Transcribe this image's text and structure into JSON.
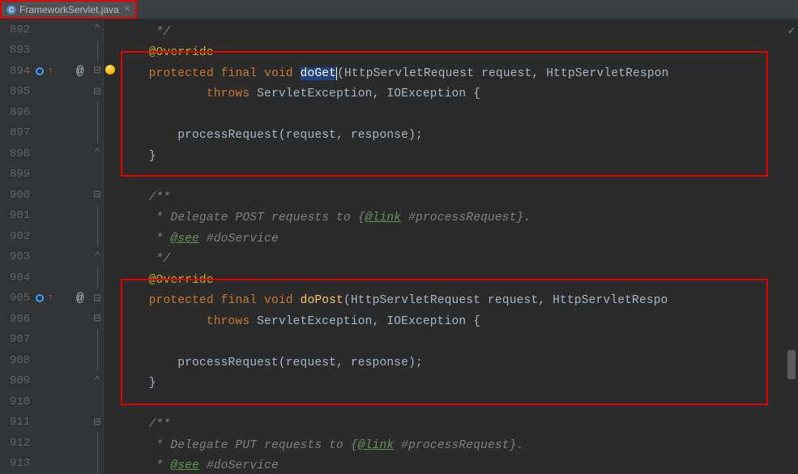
{
  "tab": {
    "filename": "FrameworkServlet.java"
  },
  "lines": {
    "l892": {
      "num": "892",
      "code": {
        "pre": "     ",
        "cm": "*/"
      }
    },
    "l893": {
      "num": "893",
      "code": {
        "pre": "    ",
        "an": "@Override"
      }
    },
    "l894": {
      "num": "894",
      "code": {
        "pre": "    ",
        "k1": "protected",
        "sp1": " ",
        "k2": "final",
        "sp2": " ",
        "k3": "void",
        "sp3": " ",
        "mth_sel": "doGet",
        "paren": "(HttpServletRequest request, HttpServletRespon"
      }
    },
    "l895": {
      "num": "895",
      "code": {
        "pre": "            ",
        "k": "throws",
        "rest": " ServletException, IOException {"
      }
    },
    "l896": {
      "num": "896"
    },
    "l897": {
      "num": "897",
      "code": {
        "pre": "        ",
        "txt": "processRequest(request, response);"
      }
    },
    "l898": {
      "num": "898",
      "code": {
        "pre": "    ",
        "txt": "}"
      }
    },
    "l899": {
      "num": "899"
    },
    "l900": {
      "num": "900",
      "code": {
        "pre": "    ",
        "cm": "/**"
      }
    },
    "l901": {
      "num": "901",
      "code": {
        "pre": "     ",
        "cm": "* Delegate POST requests to {",
        "tag": "@link",
        "cm2": " #processRequest}."
      }
    },
    "l902": {
      "num": "902",
      "code": {
        "pre": "     ",
        "cm": "* ",
        "tag": "@see",
        "cm2": " #doService"
      }
    },
    "l903": {
      "num": "903",
      "code": {
        "pre": "     ",
        "cm": "*/"
      }
    },
    "l904": {
      "num": "904",
      "code": {
        "pre": "    ",
        "an": "@Override"
      }
    },
    "l905": {
      "num": "905",
      "code": {
        "pre": "    ",
        "k1": "protected",
        "sp1": " ",
        "k2": "final",
        "sp2": " ",
        "k3": "void",
        "sp3": " ",
        "mth": "doPost",
        "paren": "(HttpServletRequest request, HttpServletRespo"
      }
    },
    "l906": {
      "num": "906",
      "code": {
        "pre": "            ",
        "k": "throws",
        "rest": " ServletException, IOException {"
      }
    },
    "l907": {
      "num": "907"
    },
    "l908": {
      "num": "908",
      "code": {
        "pre": "        ",
        "txt": "processRequest(request, response);"
      }
    },
    "l909": {
      "num": "909",
      "code": {
        "pre": "    ",
        "txt": "}"
      }
    },
    "l910": {
      "num": "910"
    },
    "l911": {
      "num": "911",
      "code": {
        "pre": "    ",
        "cm": "/**"
      }
    },
    "l912": {
      "num": "912",
      "code": {
        "pre": "     ",
        "cm": "* Delegate PUT requests to {",
        "tag": "@link",
        "cm2": " #processRequest}."
      }
    },
    "l913": {
      "num": "913",
      "code": {
        "pre": "     ",
        "cm": "* ",
        "tag": "@see",
        "cm2": " #doService"
      }
    }
  },
  "at_symbol": "@"
}
